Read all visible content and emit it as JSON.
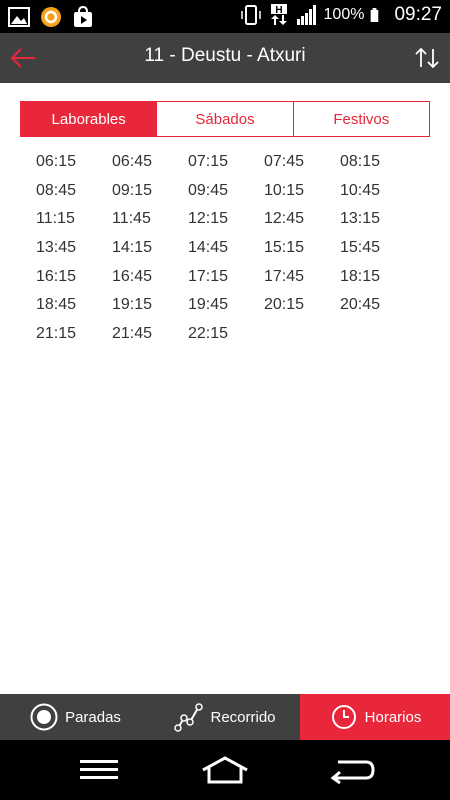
{
  "status_bar": {
    "battery": "100%",
    "time": "09:27",
    "network": "H",
    "icons": [
      "image-icon",
      "sync-app-icon",
      "play-store-icon",
      "vibrate-icon",
      "data-arrows-icon",
      "signal-icon",
      "battery-icon"
    ]
  },
  "app_bar": {
    "title": "11 - Deustu - Atxuri",
    "back_icon": "arrow-left-icon",
    "swap_icon": "swap-vertical-icon"
  },
  "tabs": [
    {
      "label": "Laborables",
      "active": true
    },
    {
      "label": "Sábados",
      "active": false
    },
    {
      "label": "Festivos",
      "active": false
    }
  ],
  "schedule": {
    "times": [
      "06:15",
      "06:45",
      "07:15",
      "07:45",
      "08:15",
      "08:45",
      "09:15",
      "09:45",
      "10:15",
      "10:45",
      "11:15",
      "11:45",
      "12:15",
      "12:45",
      "13:15",
      "13:45",
      "14:15",
      "14:45",
      "15:15",
      "15:45",
      "16:15",
      "16:45",
      "17:15",
      "17:45",
      "18:15",
      "18:45",
      "19:15",
      "19:45",
      "20:15",
      "20:45",
      "21:15",
      "21:45",
      "22:15"
    ]
  },
  "bottom_nav": [
    {
      "label": "Paradas",
      "icon": "stop-circle-icon",
      "active": false
    },
    {
      "label": "Recorrido",
      "icon": "route-icon",
      "active": false
    },
    {
      "label": "Horarios",
      "icon": "clock-icon",
      "active": true
    }
  ],
  "system_nav": {
    "icons": [
      "menu-icon",
      "home-icon",
      "back-icon"
    ]
  },
  "colors": {
    "accent": "#e8273a",
    "bar": "#404040",
    "text": "#333333"
  }
}
